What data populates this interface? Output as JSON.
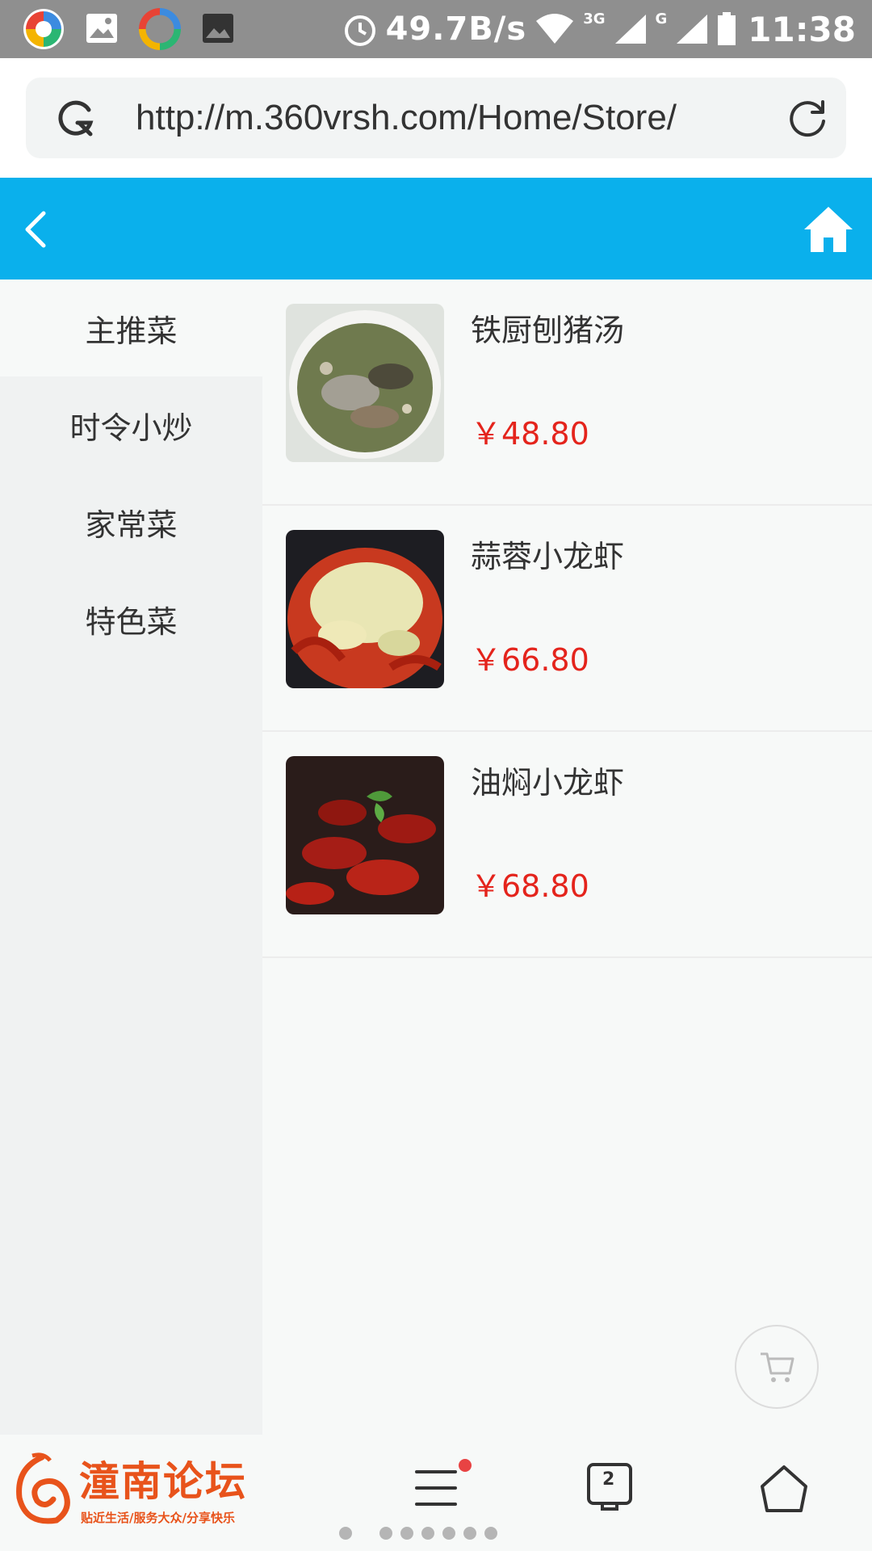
{
  "status_bar": {
    "net_speed": "49.7B/s",
    "network_a": "3G",
    "network_b": "G",
    "time": "11:38"
  },
  "browser": {
    "url": "http://m.360vrsh.com/Home/Store/"
  },
  "header": {
    "back_icon": "chevron-left-icon",
    "home_icon": "home-icon",
    "bg_color": "#0ab0ec"
  },
  "categories": [
    {
      "label": "主推菜",
      "active": true
    },
    {
      "label": "时令小炒",
      "active": false
    },
    {
      "label": "家常菜",
      "active": false
    },
    {
      "label": "特色菜",
      "active": false
    }
  ],
  "products": [
    {
      "name": "铁厨刨猪汤",
      "price": "￥48.80"
    },
    {
      "name": "蒜蓉小龙虾",
      "price": "￥66.80"
    },
    {
      "name": "油焖小龙虾",
      "price": "￥68.80"
    }
  ],
  "bottom_nav": {
    "logo_title": "潼南论坛",
    "logo_slogan": "贴近生活/服务大众/分享快乐",
    "tabs_count": "2"
  },
  "colors": {
    "accent": "#0ab0ec",
    "price": "#e4241c",
    "logo": "#e8531b"
  }
}
